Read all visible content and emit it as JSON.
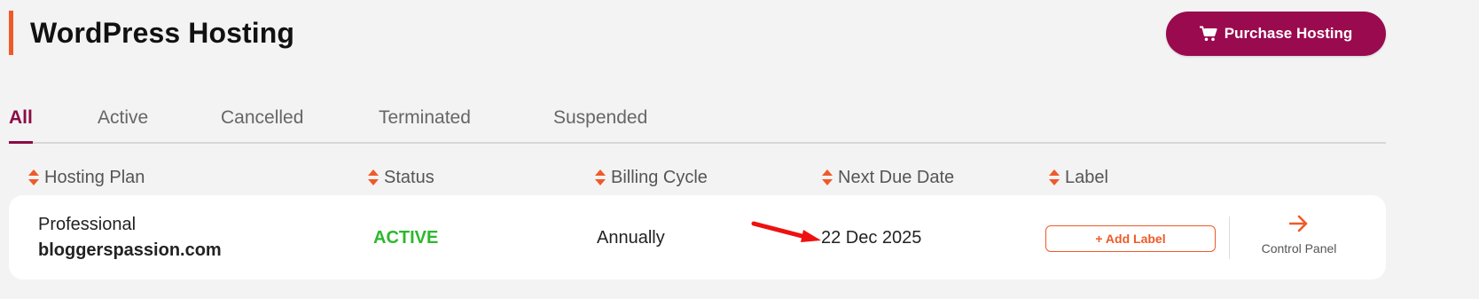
{
  "header": {
    "title": "WordPress Hosting",
    "purchase_label": "Purchase Hosting",
    "purchase_icon": "cart-icon"
  },
  "tabs": [
    {
      "label": "All",
      "active": true
    },
    {
      "label": "Active",
      "active": false
    },
    {
      "label": "Cancelled",
      "active": false
    },
    {
      "label": "Terminated",
      "active": false
    },
    {
      "label": "Suspended",
      "active": false
    }
  ],
  "columns": [
    {
      "label": "Hosting Plan"
    },
    {
      "label": "Status"
    },
    {
      "label": "Billing Cycle"
    },
    {
      "label": "Next Due Date"
    },
    {
      "label": "Label"
    }
  ],
  "rows": [
    {
      "plan": "Professional",
      "domain": "bloggerspassion.com",
      "status": "ACTIVE",
      "billing_cycle": "Annually",
      "next_due_date": "22 Dec 2025",
      "add_label": "+ Add Label",
      "control_panel": "Control Panel"
    }
  ],
  "colors": {
    "brand": "#9a0a4f",
    "accent": "#f05a28",
    "active_status": "#2db82d",
    "tab_active": "#8c0b45"
  }
}
